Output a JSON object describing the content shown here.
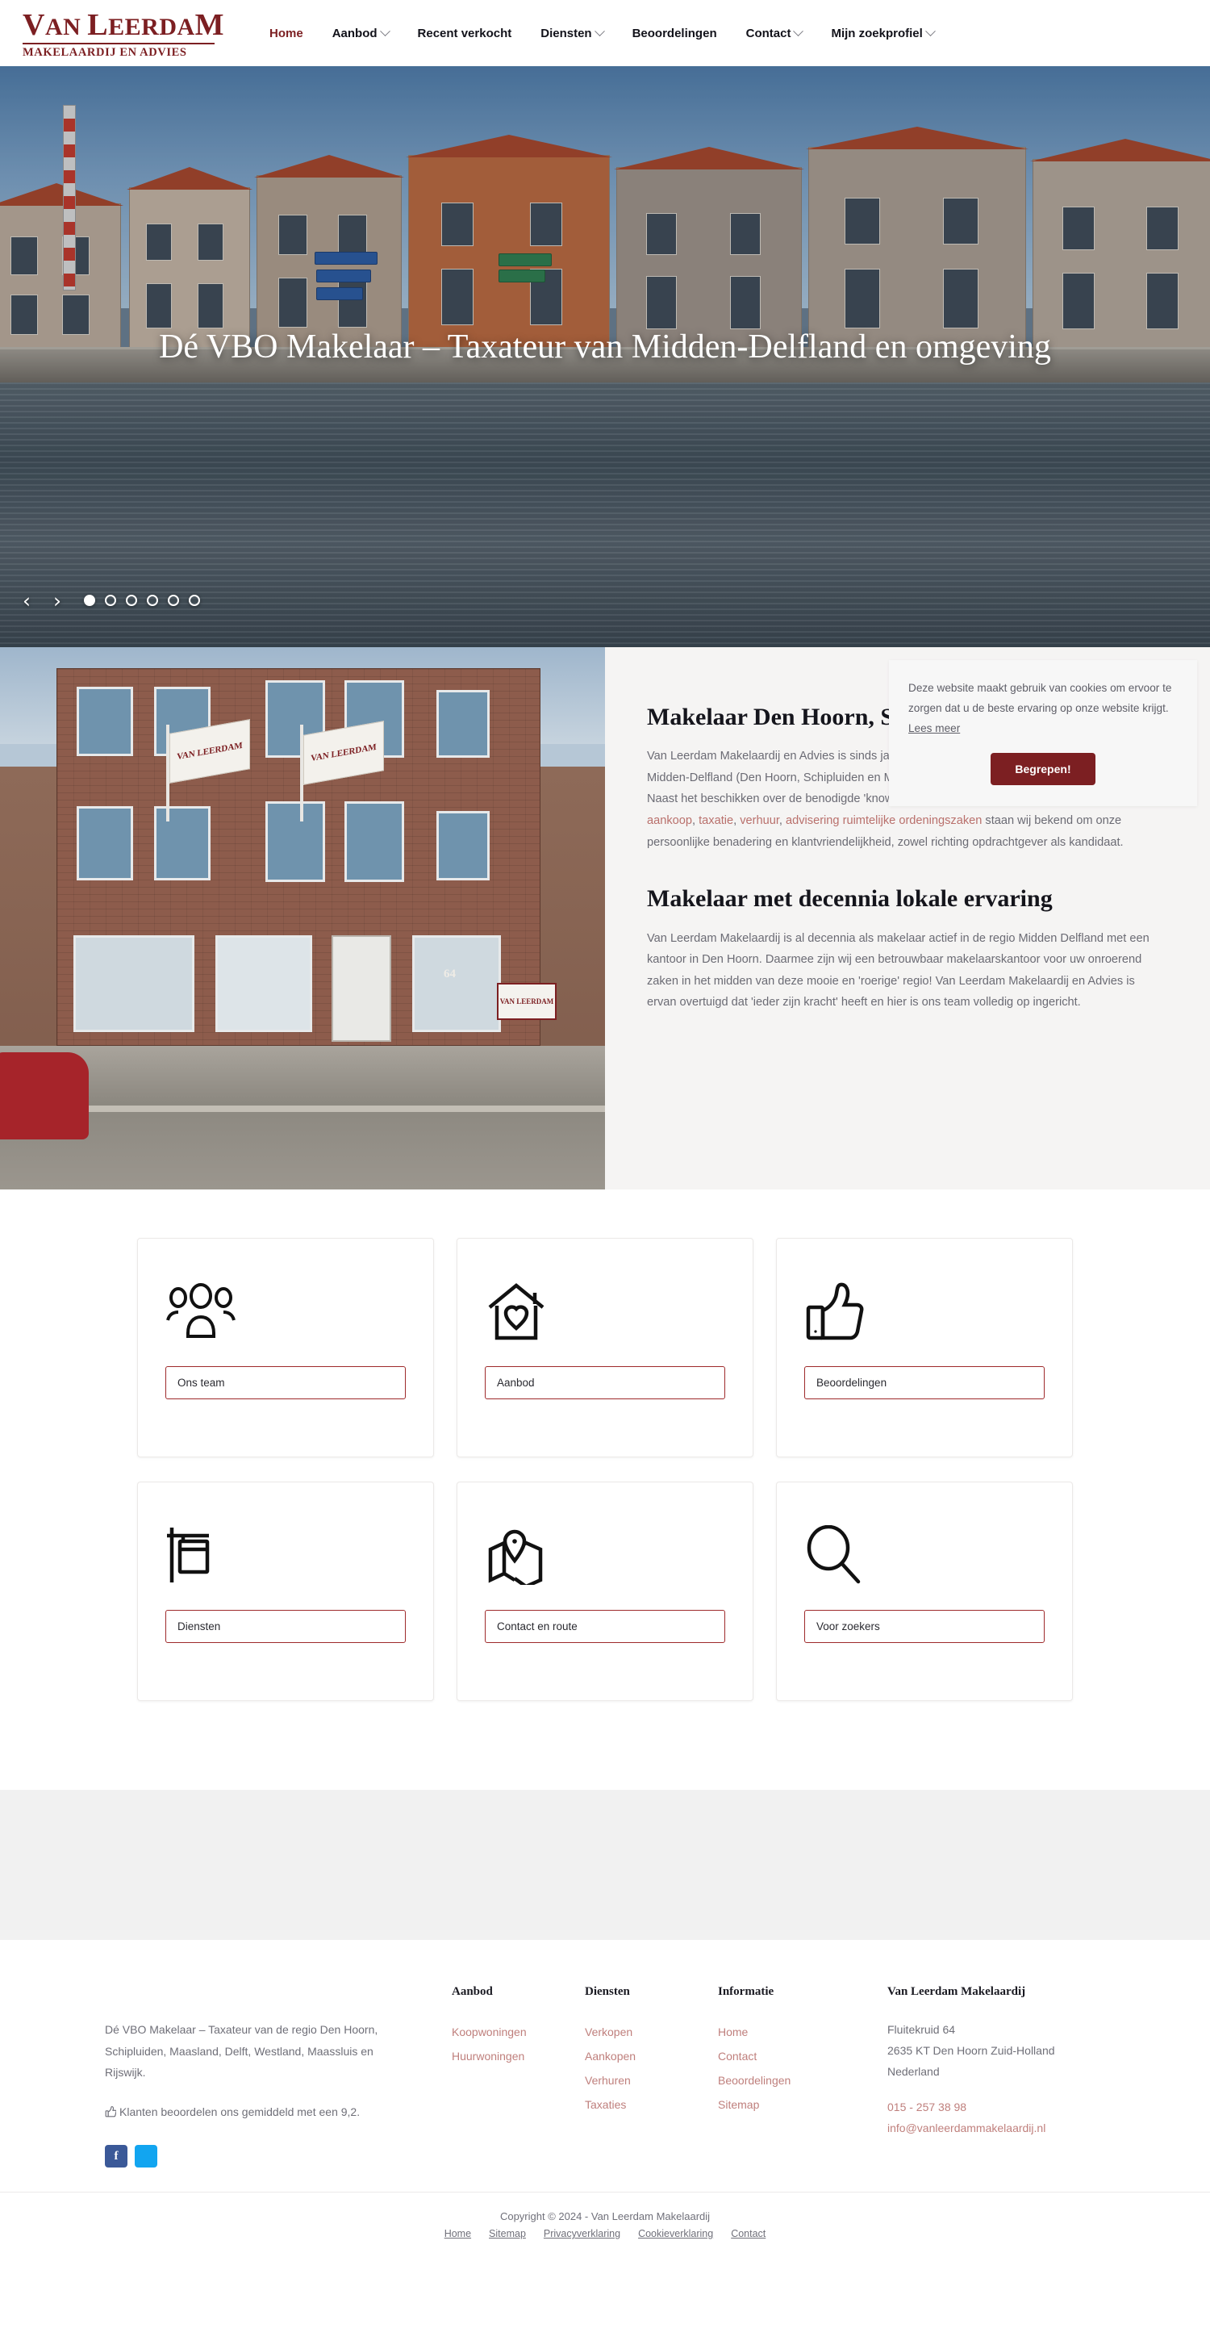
{
  "brand": {
    "logo_line1": "Van Leerdam",
    "logo_line2": "MAKELAARDIJ EN ADVIES",
    "accent": "#7c1f22",
    "link_pink": "#bf7f7c"
  },
  "nav": {
    "items": [
      {
        "label": "Home",
        "has_dropdown": false,
        "active": true
      },
      {
        "label": "Aanbod",
        "has_dropdown": true,
        "active": false
      },
      {
        "label": "Recent verkocht",
        "has_dropdown": false,
        "active": false
      },
      {
        "label": "Diensten",
        "has_dropdown": true,
        "active": false
      },
      {
        "label": "Beoordelingen",
        "has_dropdown": false,
        "active": false
      },
      {
        "label": "Contact",
        "has_dropdown": true,
        "active": false
      },
      {
        "label": "Mijn zoekprofiel",
        "has_dropdown": true,
        "active": false
      }
    ]
  },
  "hero": {
    "title": "Dé VBO Makelaar – Taxateur van Midden-Delfland en omgeving",
    "prev_label": "‹",
    "next_label": "›",
    "dot_count": 6,
    "active_dot": 1
  },
  "cookie": {
    "text": "Deze website maakt gebruik van cookies om ervoor te zorgen dat u de beste ervaring op onze website krijgt.",
    "read_more": "Lees meer",
    "accept": "Begrepen!"
  },
  "about": {
    "photo_flag_text": "VAN LEERDAM",
    "photo_board_text": "VAN LEERDAM",
    "photo_house_number": "64",
    "heading1": "Makelaar Den Hoorn, Schipluiden, Maasland",
    "paragraph1_part1": "Van Leerdam Makelaardij en Advies is sinds jaar-en-dag dé makelaar – taxateur van de regio Midden-Delfland (Den Hoorn, Schipluiden en Maasland), Delft, Westland, Maassluis en Rijswijk. Naast het beschikken over de benodigde 'know-how' voor een zo gunstig mogelijke ",
    "paragraph1_link1": "verkoop",
    "paragraph1_sep1": ", ",
    "paragraph1_link2": "aankoop",
    "paragraph1_sep2": ", ",
    "paragraph1_link3": "taxatie",
    "paragraph1_sep3": ", ",
    "paragraph1_link4": "verhuur",
    "paragraph1_sep4": ", ",
    "paragraph1_link5": "advisering ruimtelijke ordeningszaken",
    "paragraph1_part2": " staan wij bekend om onze persoonlijke benadering en klantvriendelijkheid, zowel richting opdrachtgever als kandidaat.",
    "heading2": "Makelaar met decennia lokale ervaring",
    "paragraph2": "Van Leerdam Makelaardij is al decennia als makelaar actief in de regio Midden Delfland met een kantoor in Den Hoorn. Daarmee zijn wij een betrouwbaar makelaarskantoor voor uw onroerend zaken in het midden van deze mooie en 'roerige' regio! Van Leerdam Makelaardij en Advies is ervan overtuigd dat 'ieder zijn kracht' heeft en hier is ons team volledig op ingericht."
  },
  "cards": [
    {
      "icon": "people-icon",
      "label": "Ons team"
    },
    {
      "icon": "house-heart-icon",
      "label": "Aanbod"
    },
    {
      "icon": "thumbs-up-icon",
      "label": "Beoordelingen"
    },
    {
      "icon": "for-sale-sign-icon",
      "label": "Diensten"
    },
    {
      "icon": "map-pin-icon",
      "label": "Contact en route"
    },
    {
      "icon": "magnifier-icon",
      "label": "Voor zoekers"
    }
  ],
  "footer": {
    "about_text": "Dé VBO Makelaar – Taxateur van de regio Den Hoorn, Schipluiden, Maasland, Delft, Westland, Maassluis en Rijswijk.",
    "rating_text": "Klanten beoordelen ons gemiddeld met een 9,2.",
    "socials": [
      {
        "name": "facebook-icon",
        "glyph": "f",
        "color": "#3b5998"
      },
      {
        "name": "twitter-icon",
        "glyph": "",
        "color": "#12a5f0"
      }
    ],
    "columns": [
      {
        "heading": "Aanbod",
        "links": [
          "Koopwoningen",
          "Huurwoningen"
        ]
      },
      {
        "heading": "Diensten",
        "links": [
          "Verkopen",
          "Aankopen",
          "Verhuren",
          "Taxaties"
        ]
      },
      {
        "heading": "Informatie",
        "links": [
          "Home",
          "Contact",
          "Beoordelingen",
          "Sitemap"
        ]
      }
    ],
    "contact": {
      "heading": "Van Leerdam Makelaardij",
      "address_line1": "Fluitekruid 64",
      "address_line2": "2635 KT Den Hoorn Zuid-Holland",
      "address_line3": "Nederland",
      "phone": "015 - 257 38 98",
      "email": "info@vanleerdammakelaardij.nl"
    }
  },
  "copyright": {
    "text": "Copyright © 2024 - Van Leerdam Makelaardij",
    "links": [
      "Home",
      "Sitemap",
      "Privacyverklaring",
      "Cookieverklaring",
      "Contact"
    ]
  }
}
